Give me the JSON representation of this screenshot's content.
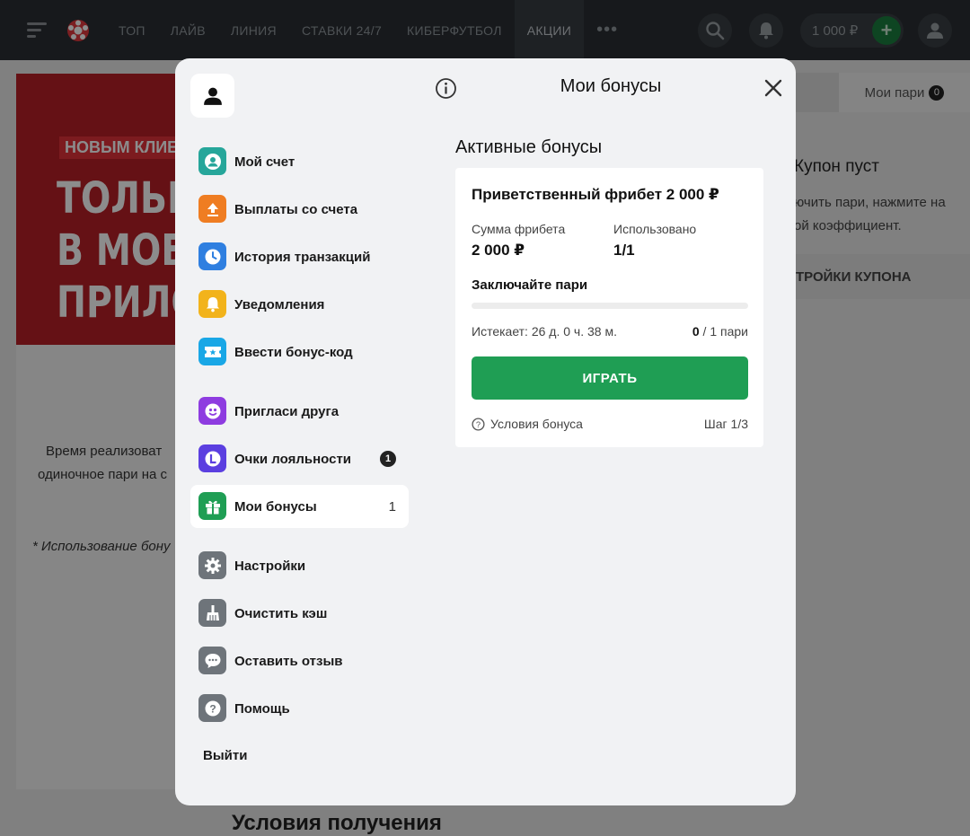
{
  "nav": {
    "links": [
      "ТОП",
      "ЛАЙВ",
      "ЛИНИЯ",
      "СТАВКИ 24/7",
      "КИБЕРФУТБОЛ",
      "АКЦИИ"
    ],
    "more": "•••",
    "balance": "1 000 ₽",
    "plus": "+"
  },
  "background": {
    "promo_tag": "НОВЫМ КЛИЕ",
    "promo_lines": [
      "ТОЛЬК",
      "В МОБИ",
      "ПРИЛО"
    ],
    "text_line1": "Время реализоват",
    "text_line2": "одиночное пари на с",
    "footnote": "* Использование бону",
    "coupon_tab": "Мои пари",
    "coupon_tab_count": "0",
    "coupon_title": "Купон пуст",
    "coupon_hint1": "ючить пари, нажмите на",
    "coupon_hint2": "ой коэффициент.",
    "coupon_settings": "ТРОЙКИ КУПОНА",
    "bottom_title": "Условия получения"
  },
  "modal": {
    "title": "Мои бонусы",
    "menu": [
      {
        "label": "Мой счет",
        "icon": "account-icon",
        "color": "#26a69a"
      },
      {
        "label": "Выплаты со счета",
        "icon": "upload-icon",
        "color": "#ef7d22"
      },
      {
        "label": "История транзакций",
        "icon": "clock-icon",
        "color": "#2f7fe0"
      },
      {
        "label": "Уведомления",
        "icon": "bell-icon",
        "color": "#f2b31b"
      },
      {
        "label": "Ввести бонус-код",
        "icon": "ticket-icon",
        "color": "#19a7e6"
      },
      {
        "label": "Пригласи друга",
        "icon": "invite-icon",
        "color": "#8e3ce0"
      },
      {
        "label": "Очки лояльности",
        "icon": "loyalty-icon",
        "color": "#5b3fe0",
        "badge": "1"
      },
      {
        "label": "Мои бонусы",
        "icon": "gift-icon",
        "color": "#1f9e54",
        "count": "1"
      },
      {
        "label": "Настройки",
        "icon": "gear-icon",
        "color": "#6e747a"
      },
      {
        "label": "Очистить кэш",
        "icon": "broom-icon",
        "color": "#6e747a"
      },
      {
        "label": "Оставить отзыв",
        "icon": "chat-icon",
        "color": "#6e747a"
      },
      {
        "label": "Помощь",
        "icon": "help-icon",
        "color": "#6e747a"
      }
    ],
    "logout": "Выйти",
    "section_title": "Активные бонусы",
    "bonus": {
      "title": "Приветственный фрибет 2 000 ₽",
      "amount_label": "Сумма фрибета",
      "amount_value": "2 000 ₽",
      "used_label": "Использовано",
      "used_value": "1/1",
      "task": "Заключайте пари",
      "progress_fraction": 0,
      "expires": "Истекает: 26 д. 0 ч. 38 м.",
      "progress_done": "0",
      "progress_total": " / 1 пари",
      "play_button": "ИГРАТЬ",
      "conditions": "Условия бонуса",
      "step": "Шаг 1/3"
    }
  }
}
